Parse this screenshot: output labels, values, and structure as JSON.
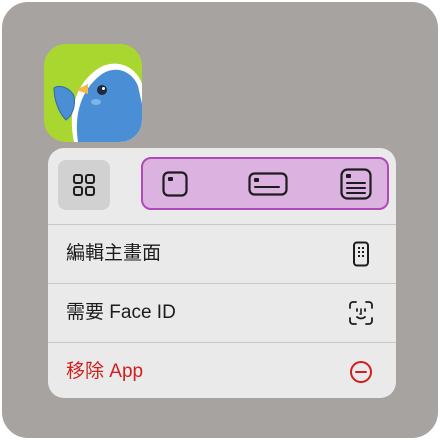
{
  "app": {
    "icon": "bird-app-icon",
    "icon_bg": "#a9d62f"
  },
  "widget_row": {
    "grid_icon": "grid-icon",
    "sizes": [
      {
        "icon": "widget-small-icon"
      },
      {
        "icon": "widget-medium-icon"
      },
      {
        "icon": "widget-large-icon"
      }
    ],
    "highlight_color": "#b04ab9"
  },
  "menu": {
    "items": [
      {
        "label": "編輯主畫面",
        "icon": "phone-edit-icon"
      },
      {
        "label": "需要 Face ID",
        "icon": "face-id-icon"
      },
      {
        "label": "移除 App",
        "icon": "minus-circle-icon",
        "color": "#d01f1f"
      }
    ]
  }
}
